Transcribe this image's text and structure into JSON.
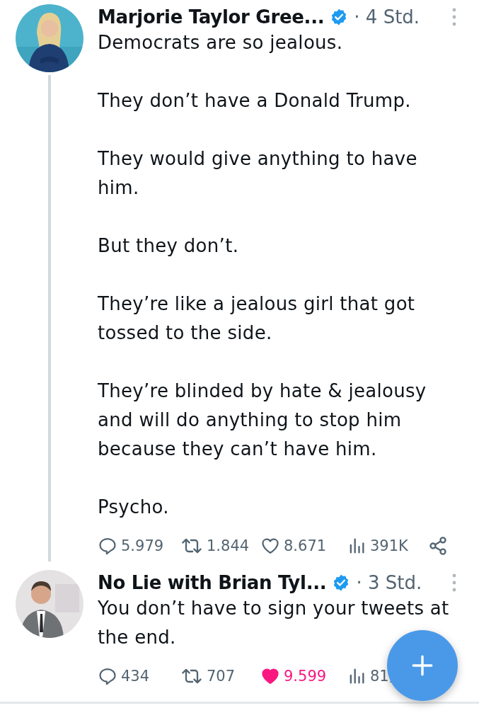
{
  "tweets": [
    {
      "avatar": {
        "kind": "picture"
      },
      "author": "Marjorie Taylor Gree...",
      "verified": true,
      "time": "· 4 Std.",
      "thread": true,
      "paragraphs": [
        "Democrats are so jealous.",
        "They don’t have a Donald Trump.",
        "They would give anything to have him.",
        "But they don’t.",
        "They’re like a jealous girl that got tossed to the side.",
        "They’re blinded by hate & jealousy and will do anything to stop him because they can’t have him.",
        "Psycho."
      ],
      "replies": "5.979",
      "retweets": "1.844",
      "likes": "8.671",
      "liked": false,
      "views": "391K",
      "share": true
    },
    {
      "avatar": {
        "kind": "picture"
      },
      "author": "No Lie with Brian Tyl...",
      "verified": true,
      "time": "· 3 Std.",
      "thread": false,
      "paragraphs": [
        "You don’t have to sign your tweets at the end."
      ],
      "replies": "434",
      "retweets": "707",
      "likes": "9.599",
      "liked": true,
      "views": "81,",
      "share": false
    }
  ]
}
